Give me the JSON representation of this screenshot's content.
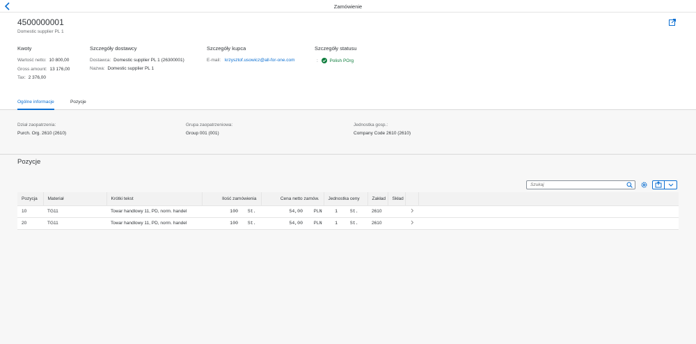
{
  "topbar": {
    "title": "Zamówienie"
  },
  "header": {
    "po_number": "4500000001",
    "subtitle": "Domestic supplier PL 1"
  },
  "amounts": {
    "title": "Kwoty",
    "net_label": "Wartość netto:",
    "net_value": "10 800,00",
    "gross_label": "Gross amount:",
    "gross_value": "13 176,00",
    "tax_label": "Tax:",
    "tax_value": "2 376,00"
  },
  "supplier": {
    "title": "Szczegóły dostawcy",
    "supplier_label": "Dostawca:",
    "supplier_value": "Domestic supplier PL 1 (26300001)",
    "name_label": "Nazwa:",
    "name_value": "Domestic supplier PL 1"
  },
  "buyer": {
    "title": "Szczegóły kupca",
    "email_label": "E-mail:",
    "email_value": "krzysztof.usowicz@all-for-one.com"
  },
  "status": {
    "title": "Szczegóły statusu",
    "colon": ":",
    "value": "Polish POrg",
    "color": "#107e3e"
  },
  "tabs": [
    {
      "label": "Ogólne informacje",
      "active": true
    },
    {
      "label": "Pozycje",
      "active": false
    }
  ],
  "general": {
    "purch_org_label": "Dział zaopatrzenia:",
    "purch_org_value": "Purch. Org. 2610 (2610)",
    "purch_group_label": "Grupa zaopatrzeniowa:",
    "purch_group_value": "Group 001 (001)",
    "company_label": "Jednostka gosp.:",
    "company_value": "Company Code 2610 (2610)"
  },
  "items": {
    "title": "Pozycje",
    "search_placeholder": "Szukaj",
    "columns": [
      "Pozycja",
      "Materiał",
      "Krótki tekst",
      "Ilość zamówienia",
      "Cena netto zamów.",
      "Jednostka ceny",
      "Zakład",
      "Skład"
    ],
    "rows": [
      {
        "item": "10",
        "material": "TG11",
        "text": "Towar handlowy 11, PD, norm. handel",
        "qty": "100",
        "uom": "St.",
        "price": "54,00",
        "currency": "PLN",
        "per": "1",
        "per_uom": "St.",
        "plant": "2610",
        "storage": ""
      },
      {
        "item": "20",
        "material": "TG11",
        "text": "Towar handlowy 11, PD, norm. handel",
        "qty": "100",
        "uom": "St.",
        "price": "54,00",
        "currency": "PLN",
        "per": "1",
        "per_uom": "St.",
        "plant": "2610",
        "storage": ""
      }
    ]
  },
  "icons": {
    "back": "back-icon",
    "share": "share-icon",
    "status": "check-circle-icon",
    "search": "search-icon",
    "settings": "gear-icon",
    "export": "export-icon",
    "dropdown": "chevron-down-icon",
    "row_nav": "chevron-right-icon"
  },
  "colors": {
    "accent": "#0a6ed1",
    "success": "#107e3e"
  }
}
